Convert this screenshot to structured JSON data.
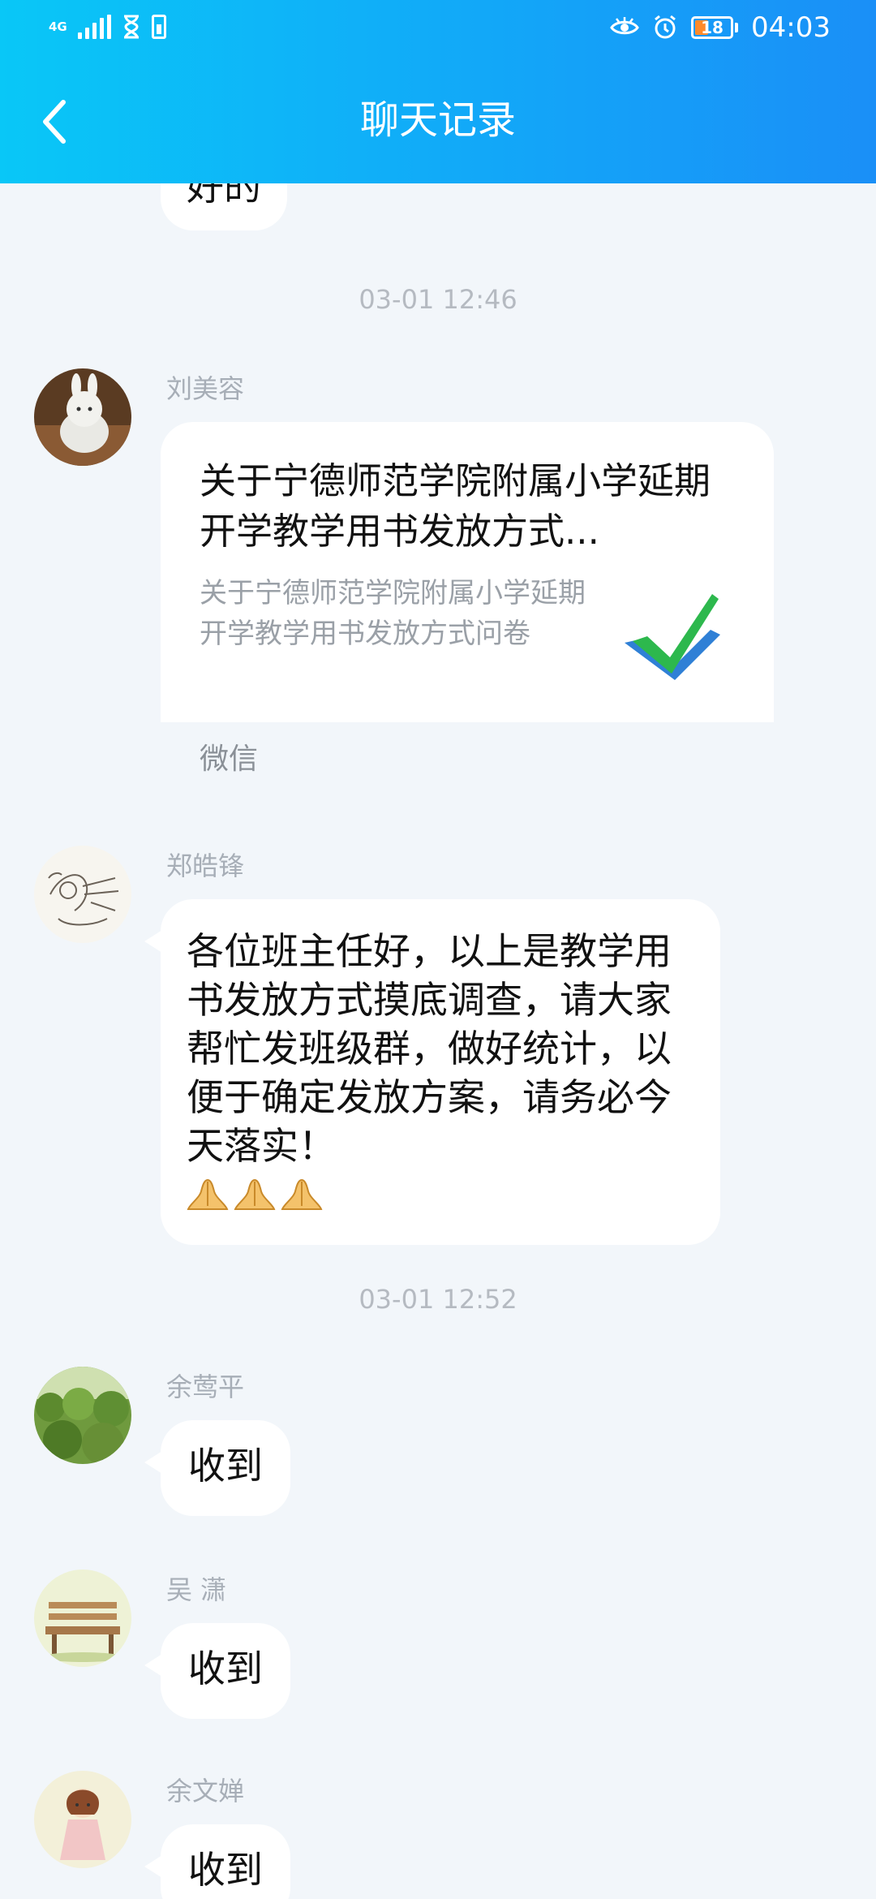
{
  "status_bar": {
    "network": "4G",
    "battery_level": "18",
    "time": "04:03"
  },
  "header": {
    "title": "聊天记录"
  },
  "previous_message": {
    "text": "好的"
  },
  "timestamps": [
    "03-01 12:46",
    "03-01 12:52"
  ],
  "messages": [
    {
      "sender": "刘美容",
      "type": "card",
      "card": {
        "title": "关于宁德师范学院附属小学延期开学教学用书发放方式...",
        "description": "关于宁德师范学院附属小学延期开学教学用书发放方式问卷",
        "source": "微信",
        "icon": "check-icon"
      }
    },
    {
      "sender": "郑皓锋",
      "type": "text",
      "text": "各位班主任好，以上是教学用书发放方式摸底调查，请大家帮忙发班级群，做好统计，以便于确定发放方案，请务必今天落实！",
      "emoji": "folded-hands-icon"
    },
    {
      "sender": "余莺平",
      "type": "text",
      "text": "收到"
    },
    {
      "sender": "吴 潇",
      "type": "text",
      "text": "收到"
    },
    {
      "sender": "余文婵",
      "type": "text",
      "text": "收到"
    }
  ],
  "colors": {
    "header_start": "#09c7f7",
    "header_end": "#1a8ff7",
    "background": "#f2f6fa",
    "bubble": "#ffffff"
  }
}
